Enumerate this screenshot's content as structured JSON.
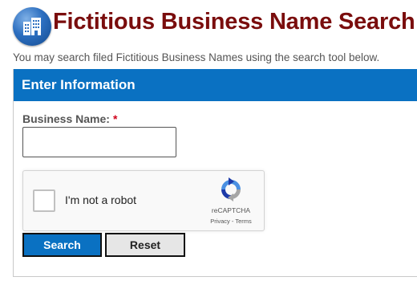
{
  "header": {
    "logo_icon": "building-icon",
    "title": "Fictitious Business Name Search",
    "subtitle": "You may search filed Fictitious Business Names using the search tool below."
  },
  "panel": {
    "heading": "Enter Information",
    "field": {
      "label": "Business Name:",
      "required_marker": "*",
      "value": "",
      "placeholder": ""
    },
    "captcha": {
      "prompt": "I'm not a robot",
      "checked": false,
      "brand": "reCAPTCHA",
      "privacy": "Privacy",
      "separator": " - ",
      "terms": "Terms",
      "icon": "recaptcha-icon"
    },
    "buttons": {
      "search": "Search",
      "reset": "Reset"
    }
  },
  "colors": {
    "title": "#7a0d0d",
    "header_bar": "#0a71c2",
    "required": "#d0021b",
    "search_button": "#0a71c2",
    "reset_button": "#e6e6e6"
  }
}
